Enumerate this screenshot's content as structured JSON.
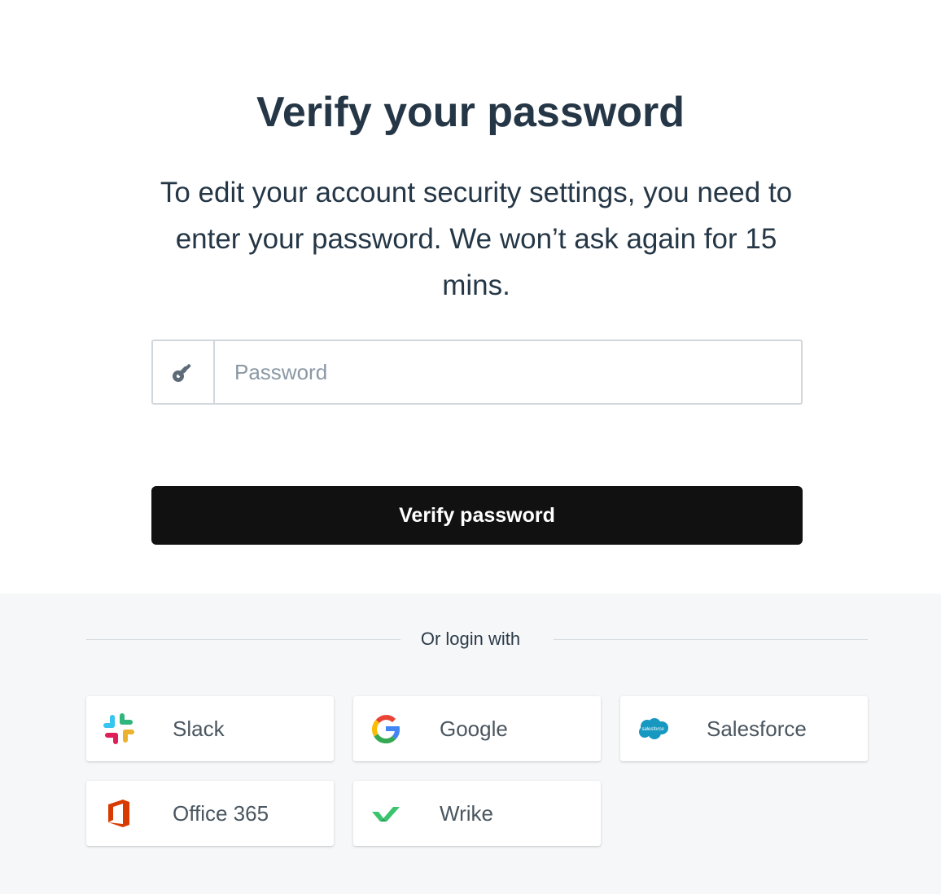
{
  "header": {
    "title": "Verify your password",
    "subtitle": "To edit your account security settings, you need to enter your password. We won’t ask again for 15 mins."
  },
  "password_field": {
    "icon": "key-icon",
    "placeholder": "Password",
    "value": ""
  },
  "verify_button": {
    "label": "Verify password"
  },
  "alt_login": {
    "divider_label": "Or login with",
    "providers": [
      {
        "label": "Slack",
        "icon": "slack-icon"
      },
      {
        "label": "Google",
        "icon": "google-icon"
      },
      {
        "label": "Salesforce",
        "icon": "salesforce-icon",
        "icon_text": "salesforce"
      },
      {
        "label": "Office 365",
        "icon": "office365-icon"
      },
      {
        "label": "Wrike",
        "icon": "wrike-icon"
      }
    ]
  },
  "colors": {
    "heading": "#253746",
    "button_bg": "#111111",
    "bottom_bg": "#f6f7f9",
    "border": "#d1d7dc"
  }
}
